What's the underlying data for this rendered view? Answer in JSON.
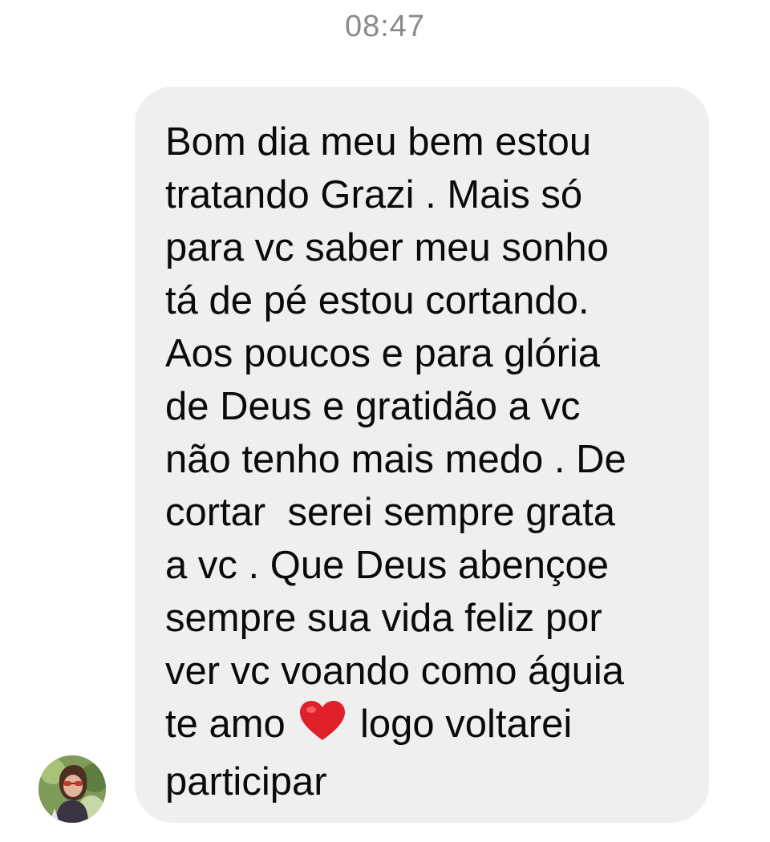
{
  "timestamp": "08:47",
  "message": {
    "lines": [
      "Bom dia meu bem estou",
      "tratando Grazi . Mais só",
      "para vc saber meu sonho",
      "tá de pé estou cortando.",
      "Aos poucos e para glória",
      "de Deus e gratidão a vc",
      "não tenho mais medo . De",
      "cortar  serei sempre grata",
      "a vc . Que Deus abençoe",
      "sempre sua vida feliz por",
      "ver vc voando como águia"
    ],
    "line_with_emoji": {
      "before": "te amo ",
      "emoji": "heart-icon",
      "after": " logo voltarei"
    },
    "last_line": "participar"
  },
  "colors": {
    "bubble_background": "#efeff0",
    "text": "#0a0a0a",
    "timestamp": "#8a8a8e",
    "heart": "#e0202a"
  }
}
